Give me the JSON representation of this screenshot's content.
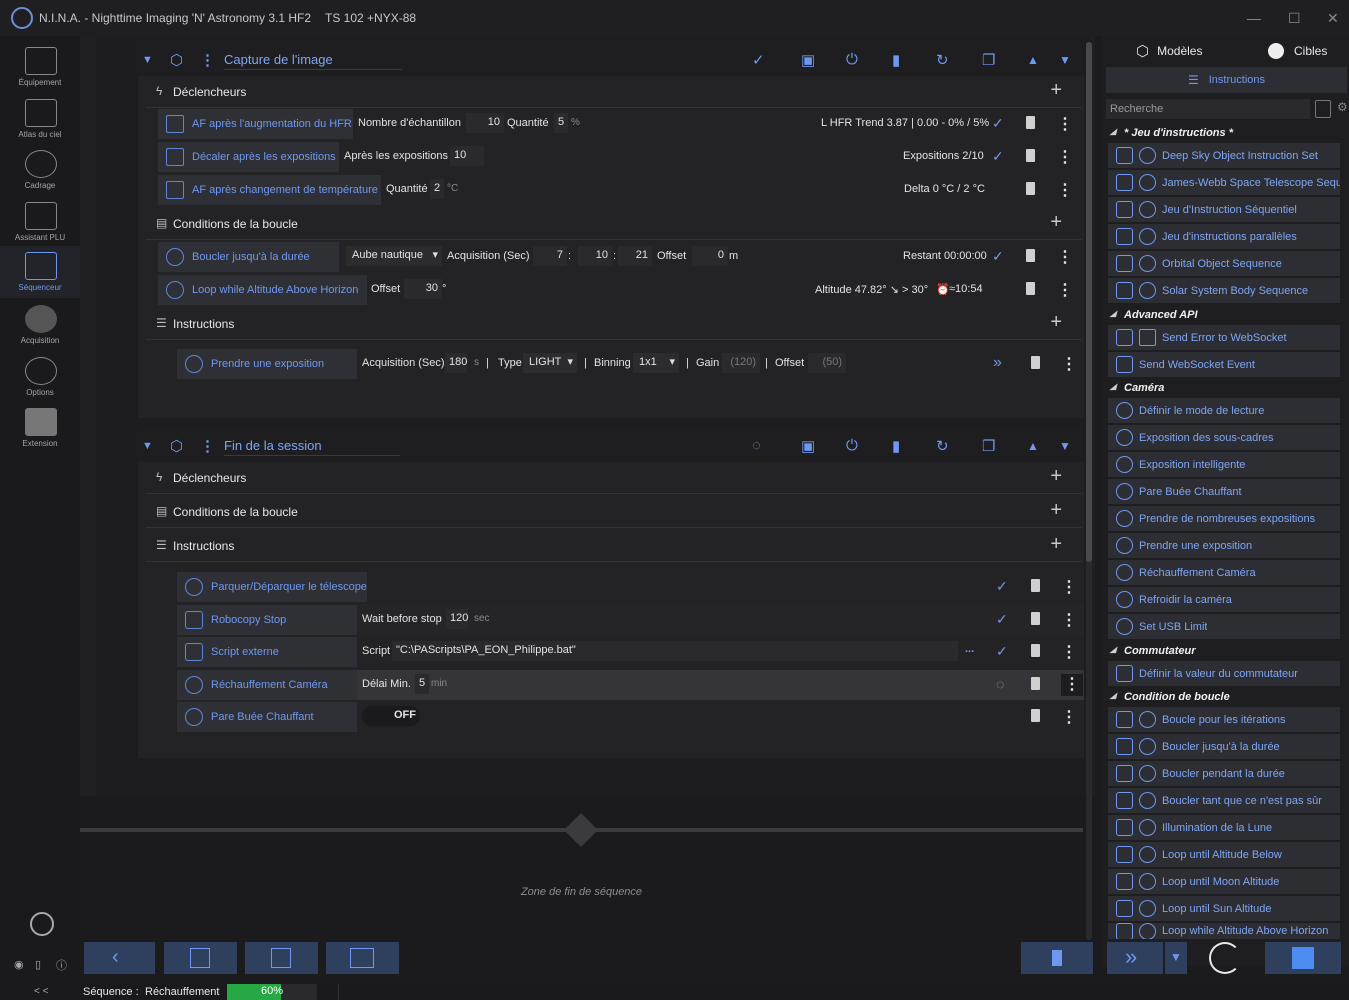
{
  "window": {
    "title": "N.I.N.A. - Nighttime Imaging 'N' Astronomy 3.1 HF2",
    "profile": "TS 102 +NYX-88"
  },
  "nav": [
    {
      "label": "Équipement",
      "icon": "telescope-icon"
    },
    {
      "label": "Atlas du ciel",
      "icon": "star-map-icon"
    },
    {
      "label": "Cadrage",
      "icon": "framing-icon"
    },
    {
      "label": "Assistant PLU",
      "icon": "flat-wizard-icon"
    },
    {
      "label": "Séquenceur",
      "icon": "sequencer-icon"
    },
    {
      "label": "Acquisition",
      "icon": "imaging-icon"
    },
    {
      "label": "Options",
      "icon": "gears-icon"
    },
    {
      "label": "Extension",
      "icon": "puzzle-icon"
    }
  ],
  "block1": {
    "title": "Capture de l'image",
    "triggers_label": "Déclencheurs",
    "loop_label": "Conditions de la boucle",
    "instr_label": "Instructions",
    "trigger1": {
      "name": "AF après l'augmentation du HFR",
      "f1": "Nombre d'échantillon",
      "v1": "10",
      "f2": "Quantité",
      "v2": "5",
      "u2": "%",
      "status": "L  HFR Trend 3.87 | 0.00 - 0% / 5%"
    },
    "trigger2": {
      "name": "Décaler après les expositions",
      "f1": "Après les expositions",
      "v1": "10",
      "status": "Expositions 2/10"
    },
    "trigger3": {
      "name": "AF après changement de température",
      "f1": "Quantité",
      "v1": "2",
      "u1": "°C",
      "status": "Delta 0 °C / 2 °C"
    },
    "loop1": {
      "name": "Boucler jusqu'à la durée",
      "sel": "Aube nautique",
      "f1": "Acquisition (Sec)",
      "h": "7",
      "m": "10",
      "s": "21",
      "f2": "Offset",
      "v2": "0",
      "u2": "m",
      "status": "Restant 00:00:00"
    },
    "loop2": {
      "name": "Loop while Altitude Above Horizon",
      "f1": "Offset",
      "v1": "30",
      "u1": "°",
      "status": "Altitude 47.82° ↘ > 30°",
      "time": "≈10:54"
    },
    "exp": {
      "name": "Prendre une exposition",
      "f1": "Acquisition (Sec)",
      "v1": "180",
      "u1": "s",
      "f2": "Type",
      "v2": "LIGHT",
      "f3": "Binning",
      "v3": "1x1",
      "f4": "Gain",
      "v4": "(120)",
      "f5": "Offset",
      "v5": "(50)"
    }
  },
  "block2": {
    "title": "Fin de la session",
    "triggers_label": "Déclencheurs",
    "loop_label": "Conditions de la boucle",
    "instr_label": "Instructions",
    "i1": {
      "name": "Parquer/Déparquer le télescope"
    },
    "i2": {
      "name": "Robocopy Stop",
      "f1": "Wait before stop",
      "v1": "120",
      "u1": "sec"
    },
    "i3": {
      "name": "Script externe",
      "f1": "Script",
      "v1": "\"C:\\PAScripts\\PA_EON_Philippe.bat\"",
      "more": "..."
    },
    "i4": {
      "name": "Réchauffement Caméra",
      "f1": "Délai Min.",
      "v1": "5",
      "u1": "min"
    },
    "i5": {
      "name": "Pare Buée Chauffant",
      "v1": "OFF"
    }
  },
  "endzone": "Zone de fin de séquence",
  "right": {
    "tab_models": "Modèles",
    "tab_targets": "Cibles",
    "tab_instr": "Instructions",
    "search_ph": "Recherche",
    "cats": [
      {
        "name": "* Jeu d'instructions *",
        "items": [
          "Deep Sky Object Instruction Set",
          "James-Webb Space Telescope Seque",
          "Jeu d'Instruction Séquentiel",
          "Jeu d'instructions parallèles",
          "Orbital Object Sequence",
          "Solar System Body Sequence"
        ]
      },
      {
        "name": "Advanced API",
        "items": [
          "Send Error to WebSocket",
          "Send WebSocket Event"
        ]
      },
      {
        "name": "Caméra",
        "items": [
          "Définir le mode de lecture",
          "Exposition des sous-cadres",
          "Exposition intelligente",
          "Pare Buée Chauffant",
          "Prendre de nombreuses expositions",
          "Prendre une exposition",
          "Réchauffement Caméra",
          "Refroidir la caméra",
          "Set USB Limit"
        ]
      },
      {
        "name": "Commutateur",
        "items": [
          "Définir la valeur du commutateur"
        ]
      },
      {
        "name": "Condition de boucle",
        "items": [
          "Boucle pour les itérations",
          "Boucler jusqu'à la durée",
          "Boucler pendant la durée",
          "Boucler tant que ce n'est pas sûr",
          "Illumination de la Lune",
          "Loop until Altitude Below",
          "Loop until Moon Altitude",
          "Loop until Sun Altitude",
          "Loop while Altitude Above Horizon"
        ]
      }
    ]
  },
  "status": {
    "label": "Séquence :",
    "value": "Réchauffement",
    "progress": 0.6,
    "progress_text": "60%"
  },
  "collapse": "< <"
}
